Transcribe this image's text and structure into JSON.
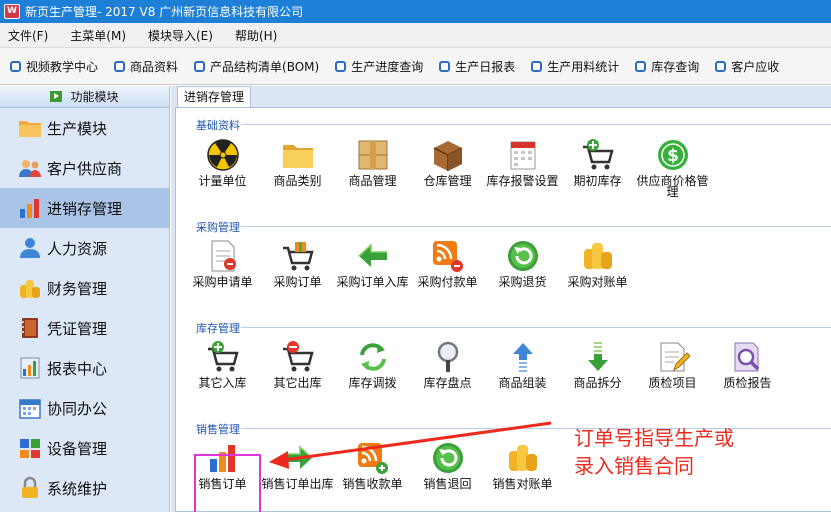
{
  "window": {
    "title": "新页生产管理- 2017 V8 广州新页信息科技有限公司"
  },
  "menu": {
    "items": [
      "文件(F)",
      "主菜单(M)",
      "模块导入(E)",
      "帮助(H)"
    ]
  },
  "toolbar": {
    "buttons": [
      "视频教学中心",
      "商品资料",
      "产品结构清单(BOM)",
      "生产进度查询",
      "生产日报表",
      "生产用料统计",
      "库存查询",
      "客户应收"
    ]
  },
  "sidebar": {
    "header": "功能模块",
    "items": [
      {
        "label": "生产模块",
        "icon": "folder-icon"
      },
      {
        "label": "客户供应商",
        "icon": "users-icon"
      },
      {
        "label": "进销存管理",
        "icon": "bar-chart-icon",
        "active": true
      },
      {
        "label": "人力资源",
        "icon": "person-icon"
      },
      {
        "label": "财务管理",
        "icon": "coins-icon"
      },
      {
        "label": "凭证管理",
        "icon": "book-icon"
      },
      {
        "label": "报表中心",
        "icon": "report-icon"
      },
      {
        "label": "协同办公",
        "icon": "calendar-icon"
      },
      {
        "label": "设备管理",
        "icon": "device-icon"
      },
      {
        "label": "系统维护",
        "icon": "lock-icon"
      }
    ]
  },
  "content": {
    "tab": "进销存管理",
    "groups": [
      {
        "label": "基础资料",
        "items": [
          {
            "label": "计量单位",
            "icon": "radiation-icon"
          },
          {
            "label": "商品类别",
            "icon": "folder-icon"
          },
          {
            "label": "商品管理",
            "icon": "box-icon"
          },
          {
            "label": "仓库管理",
            "icon": "crate-icon"
          },
          {
            "label": "库存报警设置",
            "icon": "calendar-alert-icon"
          },
          {
            "label": "期初库存",
            "icon": "cart-add-icon"
          },
          {
            "label": "供应商价格管理",
            "icon": "dollar-icon"
          }
        ]
      },
      {
        "label": "采购管理",
        "items": [
          {
            "label": "采购申请单",
            "icon": "document-icon"
          },
          {
            "label": "采购订单",
            "icon": "cart-gift-icon"
          },
          {
            "label": "采购订单入库",
            "icon": "arrow-left-icon"
          },
          {
            "label": "采购付款单",
            "icon": "rss-payment-icon"
          },
          {
            "label": "采购退货",
            "icon": "return-icon"
          },
          {
            "label": "采购对账单",
            "icon": "coins-icon"
          }
        ]
      },
      {
        "label": "库存管理",
        "items": [
          {
            "label": "其它入库",
            "icon": "cart-add-icon"
          },
          {
            "label": "其它出库",
            "icon": "cart-remove-icon"
          },
          {
            "label": "库存调拨",
            "icon": "refresh-icon"
          },
          {
            "label": "库存盘点",
            "icon": "magnifier-icon"
          },
          {
            "label": "商品组装",
            "icon": "arrow-up-icon"
          },
          {
            "label": "商品拆分",
            "icon": "arrow-down-icon"
          },
          {
            "label": "质检项目",
            "icon": "pencil-doc-icon"
          },
          {
            "label": "质检报告",
            "icon": "report-search-icon"
          }
        ]
      },
      {
        "label": "销售管理",
        "items": [
          {
            "label": "销售订单",
            "icon": "bar-chart-icon",
            "highlighted": true
          },
          {
            "label": "销售订单出库",
            "icon": "arrow-right-icon"
          },
          {
            "label": "销售收款单",
            "icon": "rss-payment-icon"
          },
          {
            "label": "销售退回",
            "icon": "return-icon"
          },
          {
            "label": "销售对账单",
            "icon": "coins-icon"
          }
        ]
      }
    ]
  },
  "annotation": {
    "lines": [
      "订单号指导生产或",
      "录入销售合同"
    ],
    "color": "#ee2a1f",
    "highlight_color": "#e135d6"
  },
  "colors": {
    "titlebar": "#1d7fd6",
    "group_label": "#1f55b4",
    "sidebar_bg": "#dce8f7",
    "sidebar_active": "#a9c4e6"
  }
}
